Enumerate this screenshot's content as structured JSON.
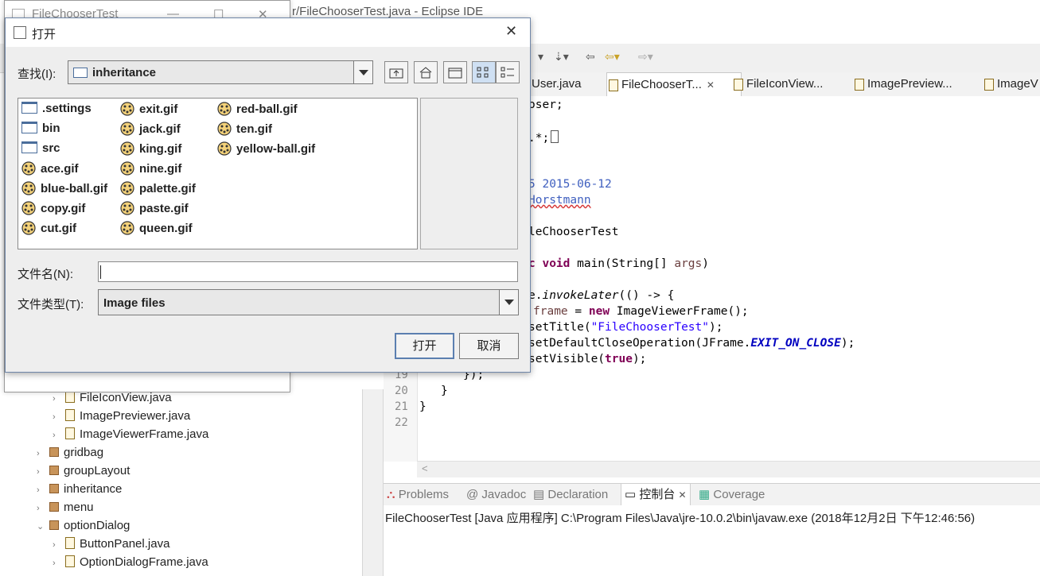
{
  "eclipse": {
    "title": "r/FileChooserTest.java - Eclipse IDE",
    "editor_tabs": [
      {
        "label": "User.java",
        "active": false
      },
      {
        "label": "FileChooserT...",
        "active": true
      },
      {
        "label": "FileIconView...",
        "active": false
      },
      {
        "label": "ImagePreview...",
        "active": false
      },
      {
        "label": "ImageV",
        "active": false
      }
    ],
    "code_lines": [
      {
        "n": "",
        "text": "oser;"
      },
      {
        "n": "",
        "text": ".*;"
      },
      {
        "n": "",
        "text": "5 2015-06-12"
      },
      {
        "n": "",
        "text": "Horstmann"
      },
      {
        "n": "",
        "text": "leChooserTest"
      },
      {
        "n": "",
        "text": "c void main(String[] args)"
      },
      {
        "n": "",
        "text": "e.invokeLater(() -> {"
      },
      {
        "n": "",
        "text": "frame = new ImageViewerFrame();"
      },
      {
        "n": "",
        "text": "setTitle(\"FileChooserTest\");"
      },
      {
        "n": "",
        "text": "setDefaultCloseOperation(JFrame.EXIT_ON_CLOSE);"
      },
      {
        "n": "",
        "text": "setVisible(true);"
      },
      {
        "n": "19",
        "text": "});"
      },
      {
        "n": "20",
        "text": "}"
      },
      {
        "n": "21",
        "text": "}"
      },
      {
        "n": "22",
        "text": ""
      }
    ],
    "console_tabs": [
      {
        "label": "Problems",
        "active": false
      },
      {
        "label": "Javadoc",
        "active": false
      },
      {
        "label": "Declaration",
        "active": false
      },
      {
        "label": "控制台",
        "active": true
      },
      {
        "label": "Coverage",
        "active": false
      }
    ],
    "console_text": "FileChooserTest [Java 应用程序] C:\\Program Files\\Java\\jre-10.0.2\\bin\\javaw.exe  (2018年12月2日 下午12:46:56)",
    "tree": [
      {
        "label": "FileIconView.java",
        "kind": "file",
        "indent": 1
      },
      {
        "label": "ImagePreviewer.java",
        "kind": "file",
        "indent": 1
      },
      {
        "label": "ImageViewerFrame.java",
        "kind": "file",
        "indent": 1
      },
      {
        "label": "gridbag",
        "kind": "package",
        "indent": 0
      },
      {
        "label": "groupLayout",
        "kind": "package",
        "indent": 0
      },
      {
        "label": "inheritance",
        "kind": "package",
        "indent": 0
      },
      {
        "label": "menu",
        "kind": "package",
        "indent": 0
      },
      {
        "label": "optionDialog",
        "kind": "package",
        "indent": 0,
        "expanded": true
      },
      {
        "label": "ButtonPanel.java",
        "kind": "file",
        "indent": 1
      },
      {
        "label": "OptionDialogFrame.java",
        "kind": "file",
        "indent": 1
      }
    ]
  },
  "background_window": {
    "title": "FileChooserTest"
  },
  "dialog": {
    "title": "打开",
    "look_in_label": "查找(I):",
    "look_in_value": "inheritance",
    "files": [
      {
        "name": ".settings",
        "type": "folder"
      },
      {
        "name": "bin",
        "type": "folder"
      },
      {
        "name": "src",
        "type": "folder"
      },
      {
        "name": "ace.gif",
        "type": "gif"
      },
      {
        "name": "blue-ball.gif",
        "type": "gif"
      },
      {
        "name": "copy.gif",
        "type": "gif"
      },
      {
        "name": "cut.gif",
        "type": "gif"
      },
      {
        "name": "exit.gif",
        "type": "gif"
      },
      {
        "name": "jack.gif",
        "type": "gif"
      },
      {
        "name": "king.gif",
        "type": "gif"
      },
      {
        "name": "nine.gif",
        "type": "gif"
      },
      {
        "name": "palette.gif",
        "type": "gif"
      },
      {
        "name": "paste.gif",
        "type": "gif"
      },
      {
        "name": "queen.gif",
        "type": "gif"
      },
      {
        "name": "red-ball.gif",
        "type": "gif"
      },
      {
        "name": "ten.gif",
        "type": "gif"
      },
      {
        "name": "yellow-ball.gif",
        "type": "gif"
      }
    ],
    "filename_label": "文件名(N):",
    "filename_value": "",
    "filetype_label": "文件类型(T):",
    "filetype_value": "Image files",
    "open_button": "打开",
    "cancel_button": "取消"
  }
}
